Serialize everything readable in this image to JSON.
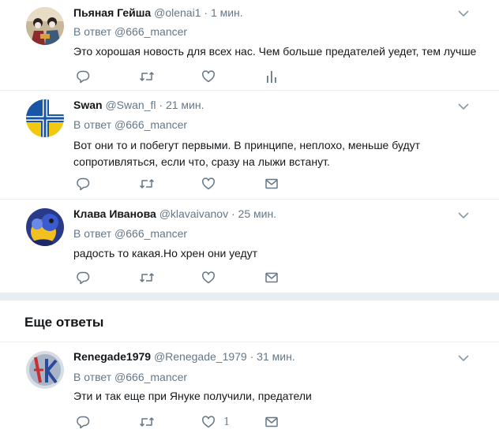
{
  "tweets": [
    {
      "name": "Пьяная Гейша",
      "handle": "@olenai1",
      "sep": "·",
      "time": "1 мин.",
      "reply_prefix": "В ответ",
      "reply_to": "@666_mancer",
      "text": "Это хорошая новость для всех нас. Чем больше предателей уедет, тем лучше",
      "actions": [
        "reply-icon",
        "retweet-icon",
        "like-icon",
        "analytics-icon"
      ]
    },
    {
      "name": "Swan",
      "handle": "@Swan_fl",
      "sep": "·",
      "time": "21 мин.",
      "reply_prefix": "В ответ",
      "reply_to": "@666_mancer",
      "text": "Вот они то и побегут первыми. В принципе, неплохо, меньше будут сопротивляться, если что, сразу на лыжи встанут.",
      "actions": [
        "reply-icon",
        "retweet-icon",
        "like-icon",
        "message-icon"
      ]
    },
    {
      "name": "Клава Иванова",
      "handle": "@klavaivanov",
      "sep": "·",
      "time": "25 мин.",
      "reply_prefix": "В ответ",
      "reply_to": "@666_mancer",
      "text": "радость то какая.Но хрен они уедут",
      "actions": [
        "reply-icon",
        "retweet-icon",
        "like-icon",
        "message-icon"
      ]
    },
    {
      "name": "Renegade1979",
      "handle": "@Renegade_1979",
      "sep": "·",
      "time": "31 мин.",
      "reply_prefix": "В ответ",
      "reply_to": "@666_mancer",
      "text": "Эти и так еще при Януке получили, предатели",
      "like_count": "1",
      "actions": [
        "reply-icon",
        "retweet-icon",
        "like-icon",
        "message-icon"
      ]
    }
  ],
  "more_replies_title": "Еще ответы",
  "colors": {
    "text": "#14171a",
    "secondary": "#657786",
    "divider": "#e6ecf0",
    "icon": "#657786"
  }
}
